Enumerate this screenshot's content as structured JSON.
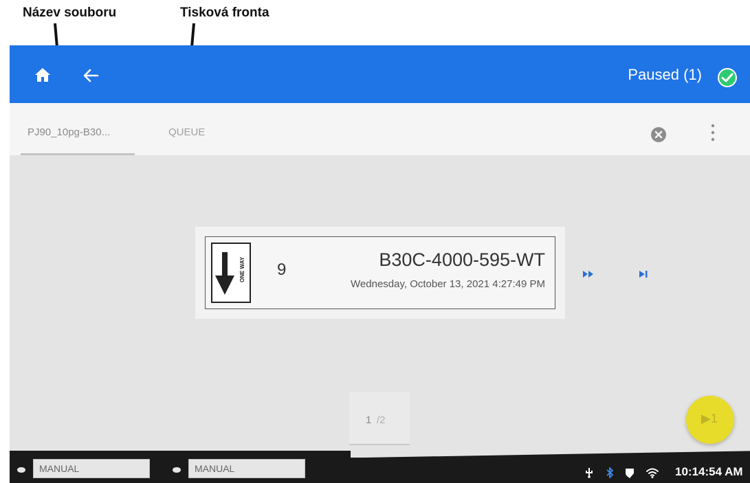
{
  "annotations": {
    "file_name_label": "Název souboru",
    "print_queue_label": "Tisková fronta"
  },
  "topbar": {
    "status": "Paused (1)",
    "icons": [
      "home-icon",
      "back-arrow-icon",
      "check-circle-icon"
    ]
  },
  "tabs": [
    {
      "label": "PJ90_10pg-B30...",
      "active": true
    },
    {
      "label": "QUEUE",
      "active": false
    }
  ],
  "job": {
    "quantity": "9",
    "name": "B30C-4000-595-WT",
    "timestamp": "Wednesday, October 13, 2021 4:27:49 PM",
    "label_icon_text": "ONE WAY"
  },
  "pager": {
    "current": "1",
    "separator": "/",
    "total": "2"
  },
  "fab": {
    "label": "▶1"
  },
  "bottombar": {
    "ribbon_mode": "MANUAL",
    "media_mode": "MANUAL",
    "time": "10:14:54 AM"
  },
  "colors": {
    "topbar": "#1f74e6",
    "accent_check": "#2ecc71",
    "fab": "#e8dc2a",
    "content_bg": "#e4e4e4"
  }
}
